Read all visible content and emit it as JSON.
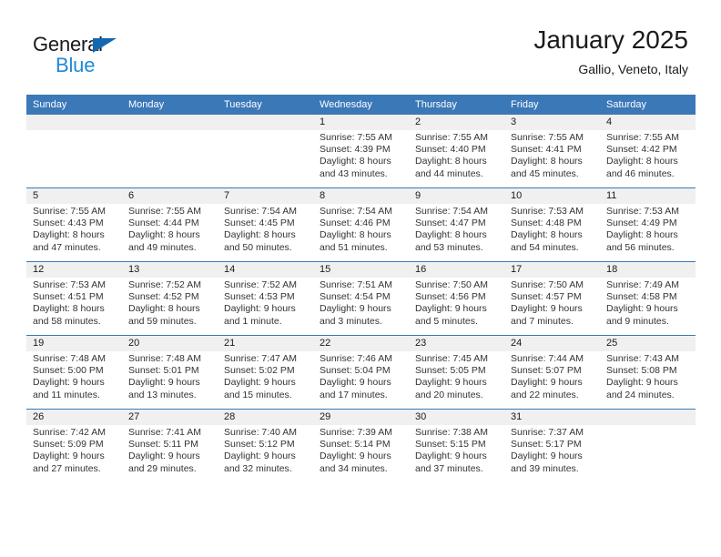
{
  "brand": {
    "name_part1": "General",
    "name_part2": "Blue",
    "logo_icon": "triangle-logo-icon",
    "colors": {
      "general": "#1a1a1a",
      "blue": "#2289d6",
      "triangle": "#1268b3"
    }
  },
  "header": {
    "title": "January 2025",
    "subtitle": "Gallio, Veneto, Italy"
  },
  "theme": {
    "header_row_bg": "#3b78b8",
    "daybar_bg": "#f0f0f0",
    "week_divider": "#3b78b8",
    "text": "#333333"
  },
  "weekday_headers": [
    "Sunday",
    "Monday",
    "Tuesday",
    "Wednesday",
    "Thursday",
    "Friday",
    "Saturday"
  ],
  "weeks": [
    [
      {
        "day": "",
        "empty": true,
        "sunrise": "",
        "sunset": "",
        "daylight_line1": "",
        "daylight_line2": ""
      },
      {
        "day": "",
        "empty": true,
        "sunrise": "",
        "sunset": "",
        "daylight_line1": "",
        "daylight_line2": ""
      },
      {
        "day": "",
        "empty": true,
        "sunrise": "",
        "sunset": "",
        "daylight_line1": "",
        "daylight_line2": ""
      },
      {
        "day": "1",
        "empty": false,
        "sunrise": "Sunrise: 7:55 AM",
        "sunset": "Sunset: 4:39 PM",
        "daylight_line1": "Daylight: 8 hours",
        "daylight_line2": "and 43 minutes."
      },
      {
        "day": "2",
        "empty": false,
        "sunrise": "Sunrise: 7:55 AM",
        "sunset": "Sunset: 4:40 PM",
        "daylight_line1": "Daylight: 8 hours",
        "daylight_line2": "and 44 minutes."
      },
      {
        "day": "3",
        "empty": false,
        "sunrise": "Sunrise: 7:55 AM",
        "sunset": "Sunset: 4:41 PM",
        "daylight_line1": "Daylight: 8 hours",
        "daylight_line2": "and 45 minutes."
      },
      {
        "day": "4",
        "empty": false,
        "sunrise": "Sunrise: 7:55 AM",
        "sunset": "Sunset: 4:42 PM",
        "daylight_line1": "Daylight: 8 hours",
        "daylight_line2": "and 46 minutes."
      }
    ],
    [
      {
        "day": "5",
        "empty": false,
        "sunrise": "Sunrise: 7:55 AM",
        "sunset": "Sunset: 4:43 PM",
        "daylight_line1": "Daylight: 8 hours",
        "daylight_line2": "and 47 minutes."
      },
      {
        "day": "6",
        "empty": false,
        "sunrise": "Sunrise: 7:55 AM",
        "sunset": "Sunset: 4:44 PM",
        "daylight_line1": "Daylight: 8 hours",
        "daylight_line2": "and 49 minutes."
      },
      {
        "day": "7",
        "empty": false,
        "sunrise": "Sunrise: 7:54 AM",
        "sunset": "Sunset: 4:45 PM",
        "daylight_line1": "Daylight: 8 hours",
        "daylight_line2": "and 50 minutes."
      },
      {
        "day": "8",
        "empty": false,
        "sunrise": "Sunrise: 7:54 AM",
        "sunset": "Sunset: 4:46 PM",
        "daylight_line1": "Daylight: 8 hours",
        "daylight_line2": "and 51 minutes."
      },
      {
        "day": "9",
        "empty": false,
        "sunrise": "Sunrise: 7:54 AM",
        "sunset": "Sunset: 4:47 PM",
        "daylight_line1": "Daylight: 8 hours",
        "daylight_line2": "and 53 minutes."
      },
      {
        "day": "10",
        "empty": false,
        "sunrise": "Sunrise: 7:53 AM",
        "sunset": "Sunset: 4:48 PM",
        "daylight_line1": "Daylight: 8 hours",
        "daylight_line2": "and 54 minutes."
      },
      {
        "day": "11",
        "empty": false,
        "sunrise": "Sunrise: 7:53 AM",
        "sunset": "Sunset: 4:49 PM",
        "daylight_line1": "Daylight: 8 hours",
        "daylight_line2": "and 56 minutes."
      }
    ],
    [
      {
        "day": "12",
        "empty": false,
        "sunrise": "Sunrise: 7:53 AM",
        "sunset": "Sunset: 4:51 PM",
        "daylight_line1": "Daylight: 8 hours",
        "daylight_line2": "and 58 minutes."
      },
      {
        "day": "13",
        "empty": false,
        "sunrise": "Sunrise: 7:52 AM",
        "sunset": "Sunset: 4:52 PM",
        "daylight_line1": "Daylight: 8 hours",
        "daylight_line2": "and 59 minutes."
      },
      {
        "day": "14",
        "empty": false,
        "sunrise": "Sunrise: 7:52 AM",
        "sunset": "Sunset: 4:53 PM",
        "daylight_line1": "Daylight: 9 hours",
        "daylight_line2": "and 1 minute."
      },
      {
        "day": "15",
        "empty": false,
        "sunrise": "Sunrise: 7:51 AM",
        "sunset": "Sunset: 4:54 PM",
        "daylight_line1": "Daylight: 9 hours",
        "daylight_line2": "and 3 minutes."
      },
      {
        "day": "16",
        "empty": false,
        "sunrise": "Sunrise: 7:50 AM",
        "sunset": "Sunset: 4:56 PM",
        "daylight_line1": "Daylight: 9 hours",
        "daylight_line2": "and 5 minutes."
      },
      {
        "day": "17",
        "empty": false,
        "sunrise": "Sunrise: 7:50 AM",
        "sunset": "Sunset: 4:57 PM",
        "daylight_line1": "Daylight: 9 hours",
        "daylight_line2": "and 7 minutes."
      },
      {
        "day": "18",
        "empty": false,
        "sunrise": "Sunrise: 7:49 AM",
        "sunset": "Sunset: 4:58 PM",
        "daylight_line1": "Daylight: 9 hours",
        "daylight_line2": "and 9 minutes."
      }
    ],
    [
      {
        "day": "19",
        "empty": false,
        "sunrise": "Sunrise: 7:48 AM",
        "sunset": "Sunset: 5:00 PM",
        "daylight_line1": "Daylight: 9 hours",
        "daylight_line2": "and 11 minutes."
      },
      {
        "day": "20",
        "empty": false,
        "sunrise": "Sunrise: 7:48 AM",
        "sunset": "Sunset: 5:01 PM",
        "daylight_line1": "Daylight: 9 hours",
        "daylight_line2": "and 13 minutes."
      },
      {
        "day": "21",
        "empty": false,
        "sunrise": "Sunrise: 7:47 AM",
        "sunset": "Sunset: 5:02 PM",
        "daylight_line1": "Daylight: 9 hours",
        "daylight_line2": "and 15 minutes."
      },
      {
        "day": "22",
        "empty": false,
        "sunrise": "Sunrise: 7:46 AM",
        "sunset": "Sunset: 5:04 PM",
        "daylight_line1": "Daylight: 9 hours",
        "daylight_line2": "and 17 minutes."
      },
      {
        "day": "23",
        "empty": false,
        "sunrise": "Sunrise: 7:45 AM",
        "sunset": "Sunset: 5:05 PM",
        "daylight_line1": "Daylight: 9 hours",
        "daylight_line2": "and 20 minutes."
      },
      {
        "day": "24",
        "empty": false,
        "sunrise": "Sunrise: 7:44 AM",
        "sunset": "Sunset: 5:07 PM",
        "daylight_line1": "Daylight: 9 hours",
        "daylight_line2": "and 22 minutes."
      },
      {
        "day": "25",
        "empty": false,
        "sunrise": "Sunrise: 7:43 AM",
        "sunset": "Sunset: 5:08 PM",
        "daylight_line1": "Daylight: 9 hours",
        "daylight_line2": "and 24 minutes."
      }
    ],
    [
      {
        "day": "26",
        "empty": false,
        "sunrise": "Sunrise: 7:42 AM",
        "sunset": "Sunset: 5:09 PM",
        "daylight_line1": "Daylight: 9 hours",
        "daylight_line2": "and 27 minutes."
      },
      {
        "day": "27",
        "empty": false,
        "sunrise": "Sunrise: 7:41 AM",
        "sunset": "Sunset: 5:11 PM",
        "daylight_line1": "Daylight: 9 hours",
        "daylight_line2": "and 29 minutes."
      },
      {
        "day": "28",
        "empty": false,
        "sunrise": "Sunrise: 7:40 AM",
        "sunset": "Sunset: 5:12 PM",
        "daylight_line1": "Daylight: 9 hours",
        "daylight_line2": "and 32 minutes."
      },
      {
        "day": "29",
        "empty": false,
        "sunrise": "Sunrise: 7:39 AM",
        "sunset": "Sunset: 5:14 PM",
        "daylight_line1": "Daylight: 9 hours",
        "daylight_line2": "and 34 minutes."
      },
      {
        "day": "30",
        "empty": false,
        "sunrise": "Sunrise: 7:38 AM",
        "sunset": "Sunset: 5:15 PM",
        "daylight_line1": "Daylight: 9 hours",
        "daylight_line2": "and 37 minutes."
      },
      {
        "day": "31",
        "empty": false,
        "sunrise": "Sunrise: 7:37 AM",
        "sunset": "Sunset: 5:17 PM",
        "daylight_line1": "Daylight: 9 hours",
        "daylight_line2": "and 39 minutes."
      },
      {
        "day": "",
        "empty": true,
        "sunrise": "",
        "sunset": "",
        "daylight_line1": "",
        "daylight_line2": ""
      }
    ]
  ]
}
